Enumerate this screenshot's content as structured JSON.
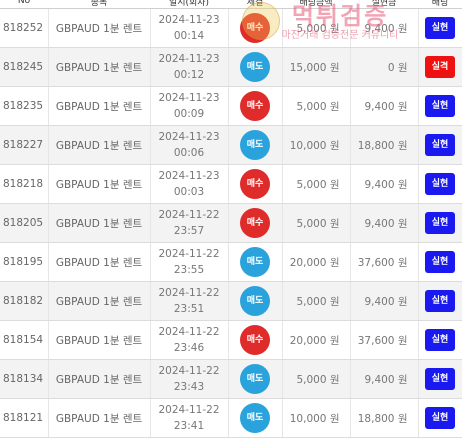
{
  "header": {
    "no": "No",
    "item": "종목",
    "time": "일시(회차)",
    "side": "체결",
    "amount": "배팅금액",
    "realize": "실현금",
    "result": "배팅"
  },
  "watermark": {
    "title": "먹튀검증",
    "subtitle": "마진거래 검증전문 커뮤니티"
  },
  "rows": [
    {
      "no": "818252",
      "item": "GBPAUD 1분 렌트",
      "date": "2024-11-23",
      "time": "00:14",
      "side": "매수",
      "side_type": "buy",
      "amount": "5,000 원",
      "realize": "9,400 원",
      "result": "실현",
      "result_type": "win"
    },
    {
      "no": "818245",
      "item": "GBPAUD 1분 렌트",
      "date": "2024-11-23",
      "time": "00:12",
      "side": "매도",
      "side_type": "sell",
      "amount": "15,000 원",
      "realize": "0 원",
      "result": "실격",
      "result_type": "lose"
    },
    {
      "no": "818235",
      "item": "GBPAUD 1분 렌트",
      "date": "2024-11-23",
      "time": "00:09",
      "side": "매수",
      "side_type": "buy",
      "amount": "5,000 원",
      "realize": "9,400 원",
      "result": "실현",
      "result_type": "win"
    },
    {
      "no": "818227",
      "item": "GBPAUD 1분 렌트",
      "date": "2024-11-23",
      "time": "00:06",
      "side": "매도",
      "side_type": "sell",
      "amount": "10,000 원",
      "realize": "18,800 원",
      "result": "실현",
      "result_type": "win"
    },
    {
      "no": "818218",
      "item": "GBPAUD 1분 렌트",
      "date": "2024-11-23",
      "time": "00:03",
      "side": "매수",
      "side_type": "buy",
      "amount": "5,000 원",
      "realize": "9,400 원",
      "result": "실현",
      "result_type": "win"
    },
    {
      "no": "818205",
      "item": "GBPAUD 1분 렌트",
      "date": "2024-11-22",
      "time": "23:57",
      "side": "매수",
      "side_type": "buy",
      "amount": "5,000 원",
      "realize": "9,400 원",
      "result": "실현",
      "result_type": "win"
    },
    {
      "no": "818195",
      "item": "GBPAUD 1분 렌트",
      "date": "2024-11-22",
      "time": "23:55",
      "side": "매도",
      "side_type": "sell",
      "amount": "20,000 원",
      "realize": "37,600 원",
      "result": "실현",
      "result_type": "win"
    },
    {
      "no": "818182",
      "item": "GBPAUD 1분 렌트",
      "date": "2024-11-22",
      "time": "23:51",
      "side": "매도",
      "side_type": "sell",
      "amount": "5,000 원",
      "realize": "9,400 원",
      "result": "실현",
      "result_type": "win"
    },
    {
      "no": "818154",
      "item": "GBPAUD 1분 렌트",
      "date": "2024-11-22",
      "time": "23:46",
      "side": "매수",
      "side_type": "buy",
      "amount": "20,000 원",
      "realize": "37,600 원",
      "result": "실현",
      "result_type": "win"
    },
    {
      "no": "818134",
      "item": "GBPAUD 1분 렌트",
      "date": "2024-11-22",
      "time": "23:43",
      "side": "매도",
      "side_type": "sell",
      "amount": "5,000 원",
      "realize": "9,400 원",
      "result": "실현",
      "result_type": "win"
    },
    {
      "no": "818121",
      "item": "GBPAUD 1분 렌트",
      "date": "2024-11-22",
      "time": "23:41",
      "side": "매도",
      "side_type": "sell",
      "amount": "10,000 원",
      "realize": "18,800 원",
      "result": "실현",
      "result_type": "win"
    }
  ]
}
